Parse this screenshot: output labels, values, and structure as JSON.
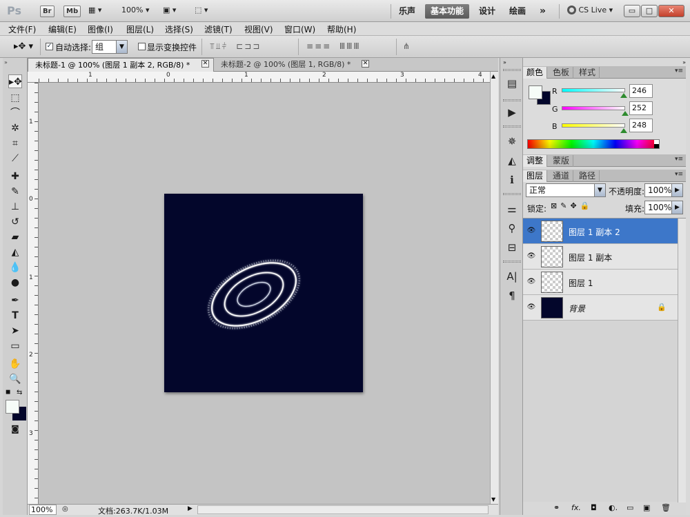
{
  "app": {
    "logo": "Ps",
    "bridge": "Br",
    "minibridge": "Mb",
    "zoom": "100%",
    "workspaces": [
      "乐声",
      "基本功能",
      "设计",
      "绘画"
    ],
    "more": "»",
    "cslive": "CS Live"
  },
  "menu": [
    "文件(F)",
    "编辑(E)",
    "图像(I)",
    "图层(L)",
    "选择(S)",
    "滤镜(T)",
    "视图(V)",
    "窗口(W)",
    "帮助(H)"
  ],
  "options": {
    "auto_select_label": "自动选择:",
    "auto_select_value": "组",
    "transform_label": "显示变换控件"
  },
  "tabs": [
    {
      "label": "未标题-1 @ 100% (图层 1 副本 2, RGB/8) *",
      "active": true
    },
    {
      "label": "未标题-2 @ 100% (图层 1, RGB/8) *",
      "active": false
    }
  ],
  "ruler_top": [
    "1",
    "0",
    "1",
    "2",
    "3",
    "4"
  ],
  "ruler_left": [
    "1",
    "0",
    "1",
    "2",
    "3"
  ],
  "status": {
    "zoom": "100%",
    "doc": "文档:263.7K/1.03M"
  },
  "color_panel": {
    "tabs": [
      "颜色",
      "色板",
      "样式"
    ],
    "R": "246",
    "G": "252",
    "B": "248",
    "fg_color": "#f6fcf8",
    "bg_color": "#03062b"
  },
  "adjust_panel": {
    "tabs": [
      "调整",
      "蒙版"
    ]
  },
  "layers_panel": {
    "tabs": [
      "图层",
      "通道",
      "路径"
    ],
    "blend_mode": "正常",
    "opacity_label": "不透明度:",
    "opacity": "100%",
    "lock_label": "锁定:",
    "fill_label": "填充:",
    "fill": "100%",
    "layers": [
      {
        "name": "图层 1 副本 2",
        "selected": true
      },
      {
        "name": "图层 1 副本",
        "selected": false
      },
      {
        "name": "图层 1",
        "selected": false
      },
      {
        "name": "背景",
        "selected": false
      }
    ],
    "footer_icons": [
      "link-icon",
      "fx-icon",
      "mask-icon",
      "adjustment-icon",
      "folder-icon",
      "new-layer-icon",
      "trash-icon"
    ]
  }
}
